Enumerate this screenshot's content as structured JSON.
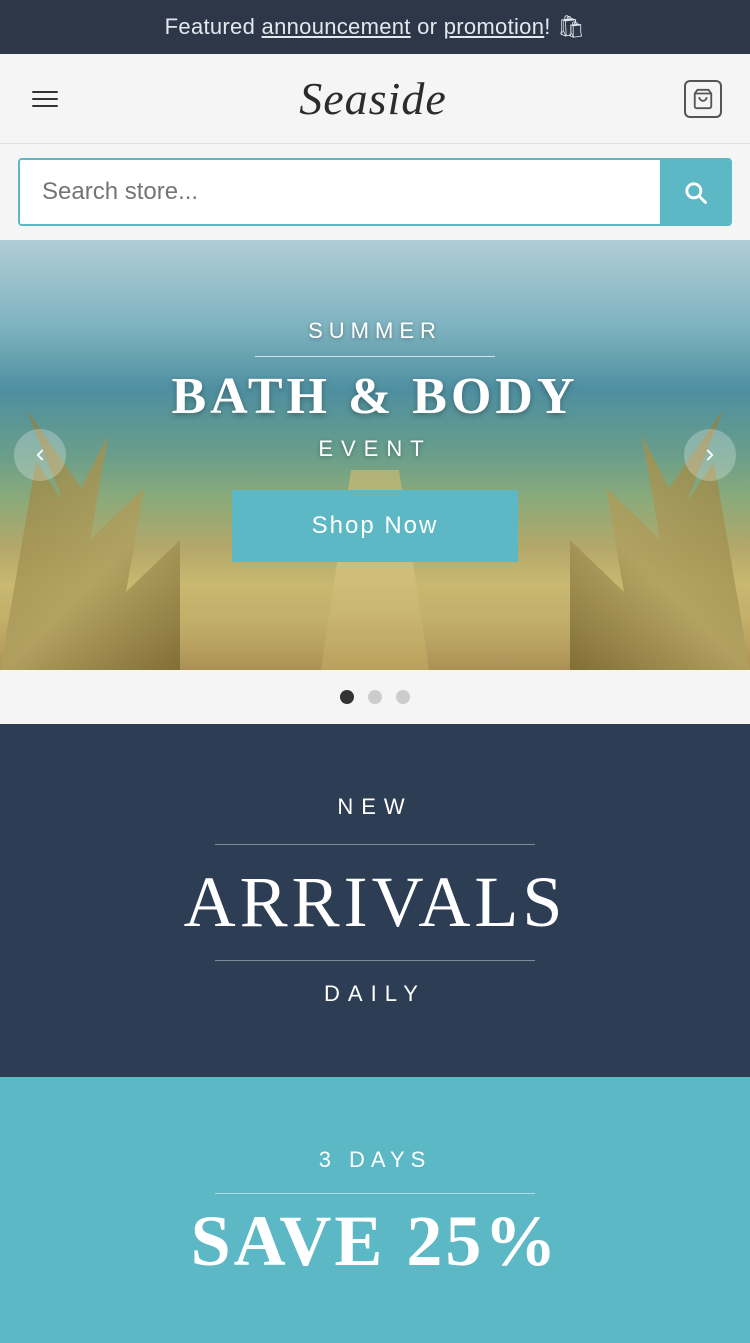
{
  "announcement": {
    "prefix": "Featured ",
    "link1": "announcement",
    "middle": " or ",
    "link2": "promotion",
    "emoji": "🛍"
  },
  "header": {
    "logo": "Seaside",
    "cart_aria": "Shopping cart"
  },
  "search": {
    "placeholder": "Search store...",
    "button_aria": "Search"
  },
  "hero": {
    "subtitle": "SUMMER",
    "title": "BATH & BODY",
    "event": "EVENT",
    "cta": "Shop Now",
    "slide_count": 3,
    "active_slide": 0
  },
  "new_arrivals": {
    "label": "NEW",
    "title": "ARRIVALS",
    "subtitle": "DAILY"
  },
  "save_section": {
    "days": "3 DAYS",
    "title": "SAVE 25%"
  },
  "dots": [
    {
      "active": true
    },
    {
      "active": false
    },
    {
      "active": false
    }
  ]
}
